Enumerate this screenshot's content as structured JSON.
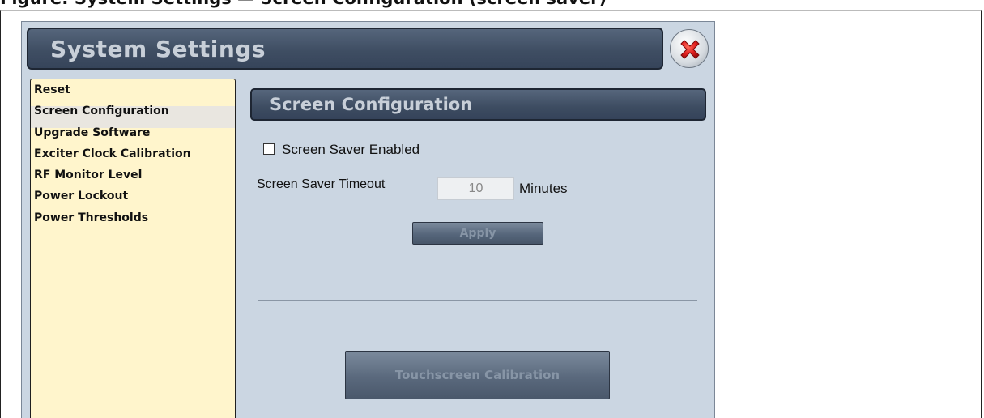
{
  "window": {
    "title": "System Settings",
    "close_icon": "close-icon",
    "accent_color": "#3f4e63",
    "close_icon_color": "#e21f1f"
  },
  "sidebar": {
    "selected": "Screen Configuration",
    "items": [
      {
        "label": "Reset"
      },
      {
        "label": "Screen Configuration"
      },
      {
        "label": "Upgrade Software"
      },
      {
        "label": "Exciter Clock Calibration"
      },
      {
        "label": "RF Monitor Level"
      },
      {
        "label": "Power Lockout"
      },
      {
        "label": "Power Thresholds"
      }
    ]
  },
  "panel": {
    "title": "Screen Configuration",
    "screen_saver_enabled_label": "Screen Saver Enabled",
    "screen_saver_enabled": false,
    "timeout_label": "Screen Saver Timeout",
    "timeout_value": "10",
    "timeout_unit": "Minutes",
    "apply_label": "Apply",
    "touchscreen_calibration_label": "Touchscreen Calibration"
  }
}
